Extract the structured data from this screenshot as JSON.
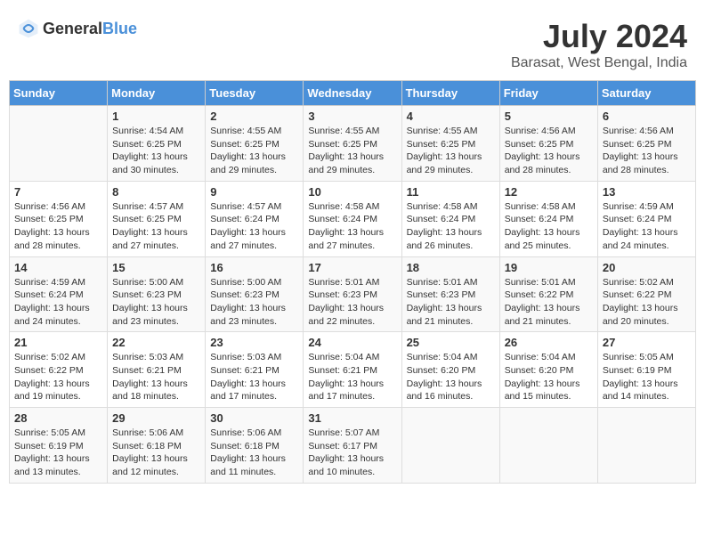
{
  "header": {
    "logo_general": "General",
    "logo_blue": "Blue",
    "month_year": "July 2024",
    "location": "Barasat, West Bengal, India"
  },
  "days_of_week": [
    "Sunday",
    "Monday",
    "Tuesday",
    "Wednesday",
    "Thursday",
    "Friday",
    "Saturday"
  ],
  "weeks": [
    [
      {
        "day": "",
        "info": ""
      },
      {
        "day": "1",
        "info": "Sunrise: 4:54 AM\nSunset: 6:25 PM\nDaylight: 13 hours\nand 30 minutes."
      },
      {
        "day": "2",
        "info": "Sunrise: 4:55 AM\nSunset: 6:25 PM\nDaylight: 13 hours\nand 29 minutes."
      },
      {
        "day": "3",
        "info": "Sunrise: 4:55 AM\nSunset: 6:25 PM\nDaylight: 13 hours\nand 29 minutes."
      },
      {
        "day": "4",
        "info": "Sunrise: 4:55 AM\nSunset: 6:25 PM\nDaylight: 13 hours\nand 29 minutes."
      },
      {
        "day": "5",
        "info": "Sunrise: 4:56 AM\nSunset: 6:25 PM\nDaylight: 13 hours\nand 28 minutes."
      },
      {
        "day": "6",
        "info": "Sunrise: 4:56 AM\nSunset: 6:25 PM\nDaylight: 13 hours\nand 28 minutes."
      }
    ],
    [
      {
        "day": "7",
        "info": "Sunrise: 4:56 AM\nSunset: 6:25 PM\nDaylight: 13 hours\nand 28 minutes."
      },
      {
        "day": "8",
        "info": "Sunrise: 4:57 AM\nSunset: 6:25 PM\nDaylight: 13 hours\nand 27 minutes."
      },
      {
        "day": "9",
        "info": "Sunrise: 4:57 AM\nSunset: 6:24 PM\nDaylight: 13 hours\nand 27 minutes."
      },
      {
        "day": "10",
        "info": "Sunrise: 4:58 AM\nSunset: 6:24 PM\nDaylight: 13 hours\nand 27 minutes."
      },
      {
        "day": "11",
        "info": "Sunrise: 4:58 AM\nSunset: 6:24 PM\nDaylight: 13 hours\nand 26 minutes."
      },
      {
        "day": "12",
        "info": "Sunrise: 4:58 AM\nSunset: 6:24 PM\nDaylight: 13 hours\nand 25 minutes."
      },
      {
        "day": "13",
        "info": "Sunrise: 4:59 AM\nSunset: 6:24 PM\nDaylight: 13 hours\nand 24 minutes."
      }
    ],
    [
      {
        "day": "14",
        "info": "Sunrise: 4:59 AM\nSunset: 6:24 PM\nDaylight: 13 hours\nand 24 minutes."
      },
      {
        "day": "15",
        "info": "Sunrise: 5:00 AM\nSunset: 6:23 PM\nDaylight: 13 hours\nand 23 minutes."
      },
      {
        "day": "16",
        "info": "Sunrise: 5:00 AM\nSunset: 6:23 PM\nDaylight: 13 hours\nand 23 minutes."
      },
      {
        "day": "17",
        "info": "Sunrise: 5:01 AM\nSunset: 6:23 PM\nDaylight: 13 hours\nand 22 minutes."
      },
      {
        "day": "18",
        "info": "Sunrise: 5:01 AM\nSunset: 6:23 PM\nDaylight: 13 hours\nand 21 minutes."
      },
      {
        "day": "19",
        "info": "Sunrise: 5:01 AM\nSunset: 6:22 PM\nDaylight: 13 hours\nand 21 minutes."
      },
      {
        "day": "20",
        "info": "Sunrise: 5:02 AM\nSunset: 6:22 PM\nDaylight: 13 hours\nand 20 minutes."
      }
    ],
    [
      {
        "day": "21",
        "info": "Sunrise: 5:02 AM\nSunset: 6:22 PM\nDaylight: 13 hours\nand 19 minutes."
      },
      {
        "day": "22",
        "info": "Sunrise: 5:03 AM\nSunset: 6:21 PM\nDaylight: 13 hours\nand 18 minutes."
      },
      {
        "day": "23",
        "info": "Sunrise: 5:03 AM\nSunset: 6:21 PM\nDaylight: 13 hours\nand 17 minutes."
      },
      {
        "day": "24",
        "info": "Sunrise: 5:04 AM\nSunset: 6:21 PM\nDaylight: 13 hours\nand 17 minutes."
      },
      {
        "day": "25",
        "info": "Sunrise: 5:04 AM\nSunset: 6:20 PM\nDaylight: 13 hours\nand 16 minutes."
      },
      {
        "day": "26",
        "info": "Sunrise: 5:04 AM\nSunset: 6:20 PM\nDaylight: 13 hours\nand 15 minutes."
      },
      {
        "day": "27",
        "info": "Sunrise: 5:05 AM\nSunset: 6:19 PM\nDaylight: 13 hours\nand 14 minutes."
      }
    ],
    [
      {
        "day": "28",
        "info": "Sunrise: 5:05 AM\nSunset: 6:19 PM\nDaylight: 13 hours\nand 13 minutes."
      },
      {
        "day": "29",
        "info": "Sunrise: 5:06 AM\nSunset: 6:18 PM\nDaylight: 13 hours\nand 12 minutes."
      },
      {
        "day": "30",
        "info": "Sunrise: 5:06 AM\nSunset: 6:18 PM\nDaylight: 13 hours\nand 11 minutes."
      },
      {
        "day": "31",
        "info": "Sunrise: 5:07 AM\nSunset: 6:17 PM\nDaylight: 13 hours\nand 10 minutes."
      },
      {
        "day": "",
        "info": ""
      },
      {
        "day": "",
        "info": ""
      },
      {
        "day": "",
        "info": ""
      }
    ]
  ]
}
